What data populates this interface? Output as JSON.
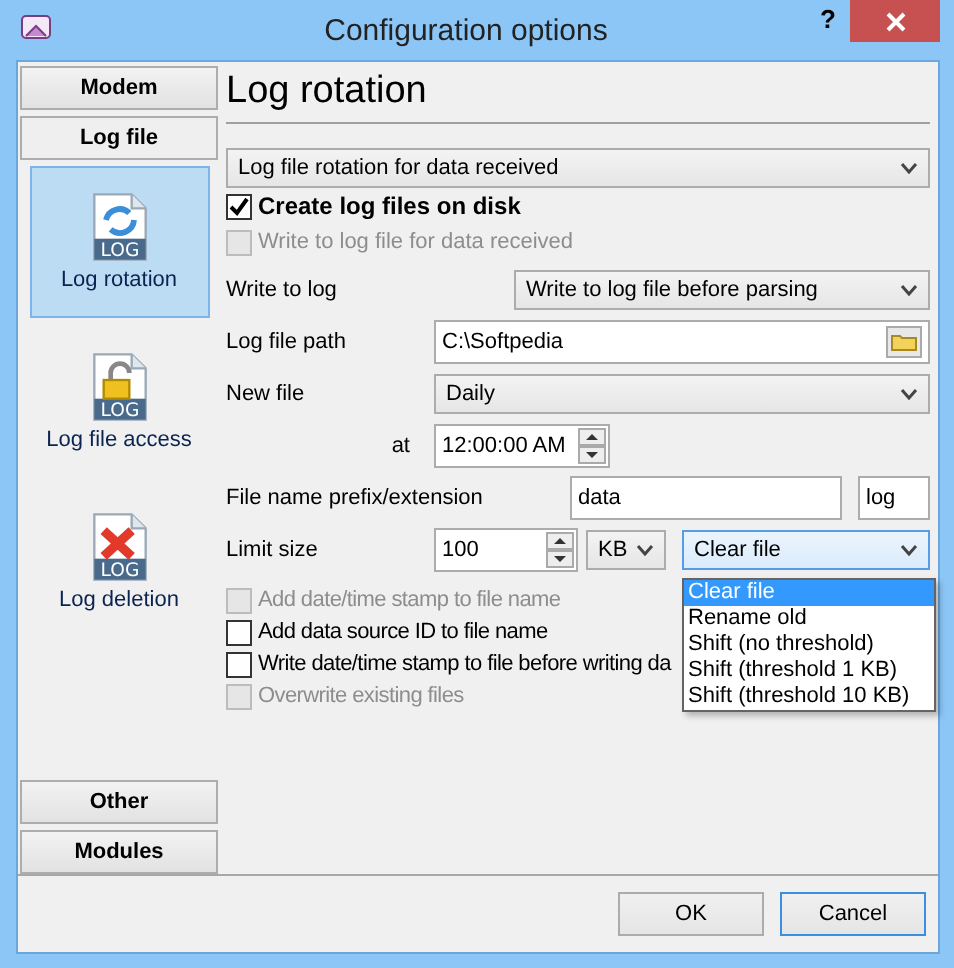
{
  "window": {
    "title": "Configuration options",
    "help": "?"
  },
  "sidebar": {
    "sections": [
      {
        "label": "Modem",
        "selected": false
      },
      {
        "label": "Log file",
        "selected": true
      }
    ],
    "items": [
      {
        "label": "Log rotation",
        "icon_text": "LOG",
        "kind": "rotation",
        "selected": true
      },
      {
        "label": "Log file access",
        "icon_text": "LOG",
        "kind": "access",
        "selected": false
      },
      {
        "label": "Log deletion",
        "icon_text": "LOG",
        "kind": "deletion",
        "selected": false
      }
    ],
    "bottom_sections": [
      {
        "label": "Other",
        "selected": false
      },
      {
        "label": "Modules",
        "selected": false
      }
    ]
  },
  "page": {
    "title": "Log rotation",
    "mode": "Log file rotation for data received",
    "create": {
      "label": "Create log files on disk",
      "checked": true,
      "disabled": false
    },
    "write_received": {
      "label": "Write to log file for data received",
      "checked": false,
      "disabled": true
    },
    "write_to_log": {
      "label": "Write to log",
      "value": "Write to log file before parsing"
    },
    "path": {
      "label": "Log file path",
      "value": "C:\\Softpedia"
    },
    "new_file": {
      "label": "New file",
      "value": "Daily"
    },
    "at": {
      "label": "at",
      "value": "12:00:00 AM"
    },
    "prefix": {
      "label": "File name prefix/extension",
      "prefix": "data",
      "extension": "log"
    },
    "limit": {
      "label": "Limit size",
      "value": "100",
      "unit": "KB",
      "action": "Clear file",
      "options": [
        {
          "label": "Clear file",
          "selected": true
        },
        {
          "label": "Rename old",
          "selected": false
        },
        {
          "label": "Shift (no threshold)",
          "selected": false
        },
        {
          "label": "Shift (threshold 1 KB)",
          "selected": false
        },
        {
          "label": "Shift (threshold 10 KB)",
          "selected": false
        }
      ]
    },
    "checks": [
      {
        "label": "Add date/time stamp to file name",
        "checked": false,
        "disabled": true
      },
      {
        "label": "Add data source ID to file name",
        "checked": false,
        "disabled": false
      },
      {
        "label": "Write date/time stamp to file before writing da",
        "checked": false,
        "disabled": false
      },
      {
        "label": "Overwrite existing files",
        "checked": false,
        "disabled": true
      }
    ]
  },
  "buttons": [
    {
      "label": "OK",
      "selected": false
    },
    {
      "label": "Cancel",
      "selected": true
    }
  ]
}
